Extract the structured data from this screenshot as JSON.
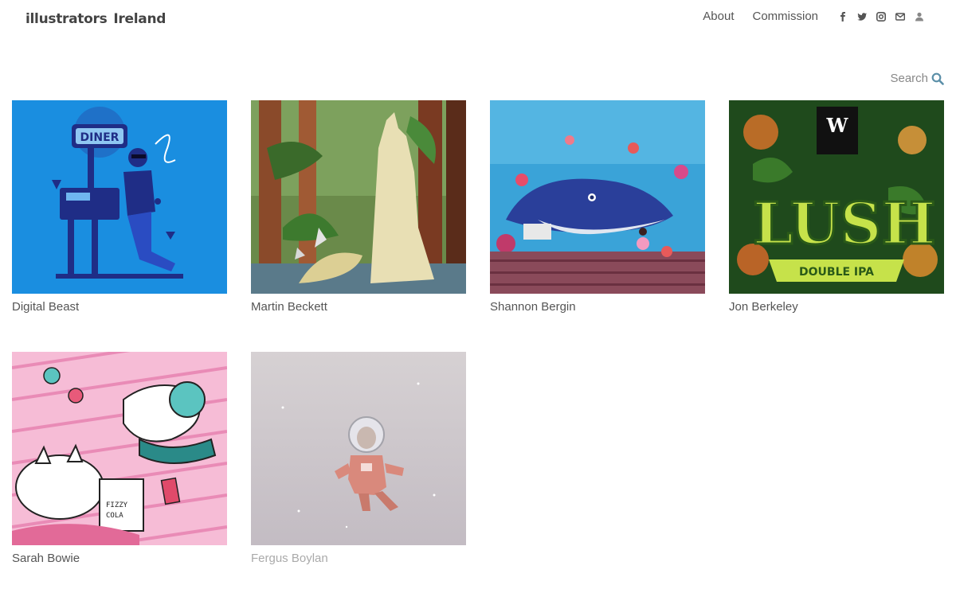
{
  "header": {
    "logo_part1": "illustrators",
    "logo_part2": "Ireland",
    "nav": [
      {
        "label": "About"
      },
      {
        "label": "Commission"
      }
    ],
    "social_icons": [
      "facebook-icon",
      "twitter-icon",
      "instagram-icon",
      "mail-icon",
      "user-icon"
    ]
  },
  "search": {
    "label": "Search"
  },
  "illustrators": [
    {
      "name": "Digital Beast",
      "thumb_color": "#1a8ee0"
    },
    {
      "name": "Martin Beckett",
      "thumb_color": "#4a6b3a"
    },
    {
      "name": "Shannon Bergin",
      "thumb_color": "#2f86c9"
    },
    {
      "name": "Jon Berkeley",
      "thumb_color": "#1f4a1c"
    },
    {
      "name": "Sarah Bowie",
      "thumb_color": "#f2a7c8"
    },
    {
      "name": "Fergus Boylan",
      "thumb_color": "#cfcacb"
    }
  ]
}
